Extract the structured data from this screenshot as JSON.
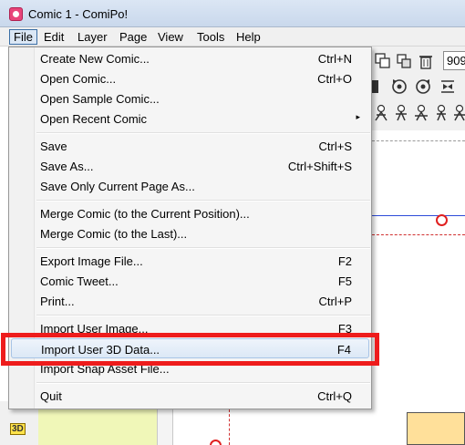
{
  "window": {
    "title": "Comic 1 - ComiPo!"
  },
  "menubar": {
    "items": [
      {
        "label": "File"
      },
      {
        "label": "Edit"
      },
      {
        "label": "Layer"
      },
      {
        "label": "Page"
      },
      {
        "label": "View"
      },
      {
        "label": "Tools"
      },
      {
        "label": "Help"
      }
    ]
  },
  "toolbar": {
    "zoom": "909"
  },
  "file_menu": {
    "items": [
      {
        "label": "Create New Comic...",
        "shortcut": "Ctrl+N"
      },
      {
        "label": "Open Comic...",
        "shortcut": "Ctrl+O"
      },
      {
        "label": "Open Sample Comic...",
        "shortcut": ""
      },
      {
        "label": "Open Recent Comic",
        "shortcut": ""
      },
      {
        "label": "Save",
        "shortcut": "Ctrl+S"
      },
      {
        "label": "Save As...",
        "shortcut": "Ctrl+Shift+S"
      },
      {
        "label": "Save Only Current Page As...",
        "shortcut": ""
      },
      {
        "label": "Merge Comic (to the Current Position)...",
        "shortcut": ""
      },
      {
        "label": "Merge Comic (to the Last)...",
        "shortcut": ""
      },
      {
        "label": "Export Image File...",
        "shortcut": "F2"
      },
      {
        "label": "Comic Tweet...",
        "shortcut": "F5"
      },
      {
        "label": "Print...",
        "shortcut": "Ctrl+P"
      },
      {
        "label": "Import User Image...",
        "shortcut": "F3"
      },
      {
        "label": "Import User 3D Data...",
        "shortcut": "F4"
      },
      {
        "label": "Import Snap Asset File...",
        "shortcut": ""
      },
      {
        "label": "Quit",
        "shortcut": "Ctrl+Q"
      }
    ],
    "submenu_arrow": "▸"
  },
  "left_panel": {
    "badge": "3D"
  },
  "colors": {
    "highlight": "#ee1c1c",
    "menu_hover": "#dce8f6",
    "accent_line": "#2d4bd8"
  }
}
